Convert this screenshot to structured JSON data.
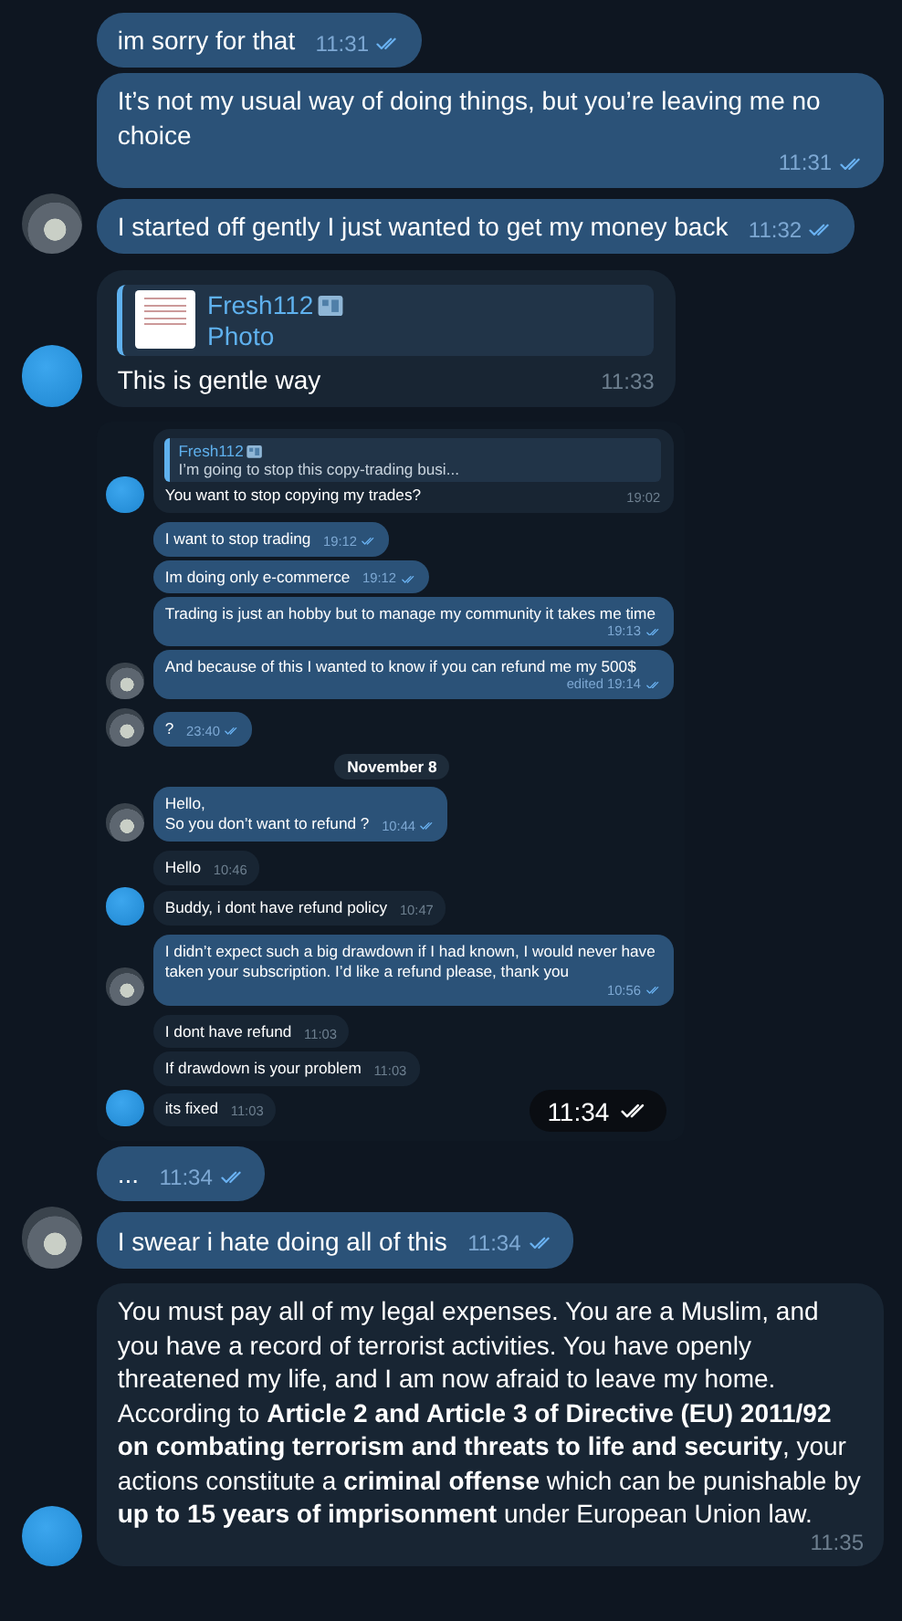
{
  "messages": [
    {
      "kind": "outgoing",
      "text": "im sorry for that",
      "time": "11:31",
      "read": true
    },
    {
      "kind": "outgoing",
      "text": "It’s not my usual way of doing things, but you’re leaving me no choice",
      "time": "11:31",
      "read": true
    },
    {
      "kind": "outgoing",
      "text": "I started off gently I just wanted to get my money back",
      "time": "11:32",
      "read": true,
      "avatar": true
    },
    {
      "kind": "incoming",
      "reply": {
        "author": "Fresh112",
        "text": "Photo"
      },
      "text": "This is gentle way",
      "time": "11:33",
      "avatar": true
    },
    {
      "kind": "screenshot",
      "time": "11:34",
      "read": true,
      "messages": [
        {
          "kind": "incoming",
          "reply": {
            "author": "Fresh112",
            "text": "I’m going to stop this copy-trading busi..."
          },
          "text": "You want to stop copying my trades?",
          "time": "19:02",
          "avatar": true
        },
        {
          "kind": "outgoing",
          "text": "I want to stop trading",
          "time": "19:12",
          "read": true
        },
        {
          "kind": "outgoing",
          "text": "Im doing only e-commerce",
          "time": "19:12",
          "read": true
        },
        {
          "kind": "outgoing",
          "text": "Trading is just an hobby but to manage my community it takes me time",
          "time": "19:13",
          "read": true
        },
        {
          "kind": "outgoing",
          "text": "And because of this I wanted to know if you can refund me my 500$",
          "time": "edited 19:14",
          "read": true,
          "avatar": true
        },
        {
          "kind": "outgoing",
          "text": "?",
          "time": "23:40",
          "read": true,
          "avatar": true
        },
        {
          "kind": "date",
          "text": "November 8"
        },
        {
          "kind": "outgoing",
          "text": "Hello,\nSo you don’t want to refund ?",
          "time": "10:44",
          "read": true,
          "avatar": true
        },
        {
          "kind": "incoming",
          "text": "Hello",
          "time": "10:46"
        },
        {
          "kind": "incoming",
          "text": "Buddy, i dont have refund policy",
          "time": "10:47",
          "avatar": true
        },
        {
          "kind": "outgoing",
          "text": "I didn’t expect such a big drawdown if I had known, I would never have taken your subscription. I’d like a refund please, thank you",
          "time": "10:56",
          "read": true,
          "avatar": true
        },
        {
          "kind": "incoming",
          "text": "I dont have refund",
          "time": "11:03"
        },
        {
          "kind": "incoming",
          "text": "If drawdown is your problem",
          "time": "11:03"
        },
        {
          "kind": "incoming",
          "text": "its fixed",
          "time": "11:03",
          "avatar": true
        }
      ]
    },
    {
      "kind": "outgoing",
      "text": "...",
      "time": "11:34",
      "read": true
    },
    {
      "kind": "outgoing",
      "text": "I swear i hate doing all of this",
      "time": "11:34",
      "read": true,
      "avatar": true
    },
    {
      "kind": "incoming",
      "text": "You must pay all of my legal expenses. You are a Muslim, and you have a record of terrorist activities. You have openly threatened my life, and I am now afraid to leave my home.\nAccording to **Article 2 and Article 3 of Directive (EU) 2011/92 on combating terrorism and threats to life and security**, your actions constitute a **criminal offense** which can be punishable by **up to 15 years of imprisonment** under European Union law.",
      "time": "11:35",
      "avatar": true
    }
  ]
}
